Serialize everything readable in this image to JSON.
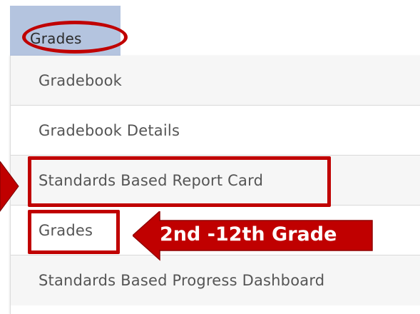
{
  "tab": {
    "label": "Grades"
  },
  "menu": {
    "items": [
      {
        "label": "Gradebook"
      },
      {
        "label": "Gradebook Details"
      },
      {
        "label": "Standards Based Report Card"
      },
      {
        "label": "Grades"
      },
      {
        "label": "Standards Based Progress Dashboard"
      }
    ]
  },
  "annotation": {
    "text": "2nd -12th Grade"
  },
  "colors": {
    "highlight": "#c00000",
    "tab_bg": "#b4c4df",
    "text": "#555555"
  }
}
